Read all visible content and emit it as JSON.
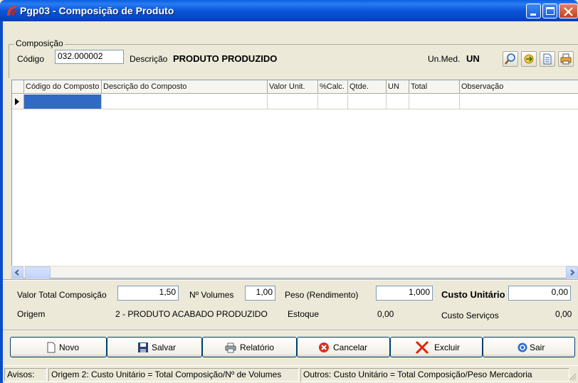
{
  "window": {
    "title": "Pgp03 - Composição de Produto"
  },
  "composicao": {
    "legend": "Composição",
    "codigo_label": "Código",
    "codigo_value": "032.000002",
    "descricao_label": "Descrição",
    "descricao_value": "PRODUTO PRODUZIDO",
    "unmed_label": "Un.Med.",
    "unmed_value": "UN"
  },
  "toolbar_icons": [
    "search-icon",
    "arrow-refresh-icon",
    "document-icon",
    "printer-icon"
  ],
  "grid": {
    "columns": [
      "Código do Composto",
      "Descrição do Composto",
      "Valor Unit.",
      "%Calc.",
      "Qtde.",
      "UN",
      "Total",
      "Observação"
    ]
  },
  "totals": {
    "valor_total_label": "Valor Total Composição",
    "valor_total_value": "1,50",
    "volumes_label": "Nº Volumes",
    "volumes_value": "1,00",
    "peso_label": "Peso (Rendimento)",
    "peso_value": "1,000",
    "custo_unit_label": "Custo Unitário",
    "custo_unit_value": "0,00",
    "origem_label": "Origem",
    "origem_value": "2 - PRODUTO ACABADO PRODUZIDO",
    "estoque_label": "Estoque",
    "estoque_value": "0,00",
    "custo_serv_label": "Custo Serviços",
    "custo_serv_value": "0,00"
  },
  "buttons": {
    "novo": "Novo",
    "salvar": "Salvar",
    "relatorio": "Relatório",
    "cancelar": "Cancelar",
    "excluir": "Excluir",
    "sair": "Sair"
  },
  "status": {
    "avisos": "Avisos:",
    "origem2": "Origem 2: Custo Unitário = Total Composição/Nº de Volumes",
    "outros": "Outros: Custo Unitário = Total Composição/Peso Mercadoria"
  }
}
